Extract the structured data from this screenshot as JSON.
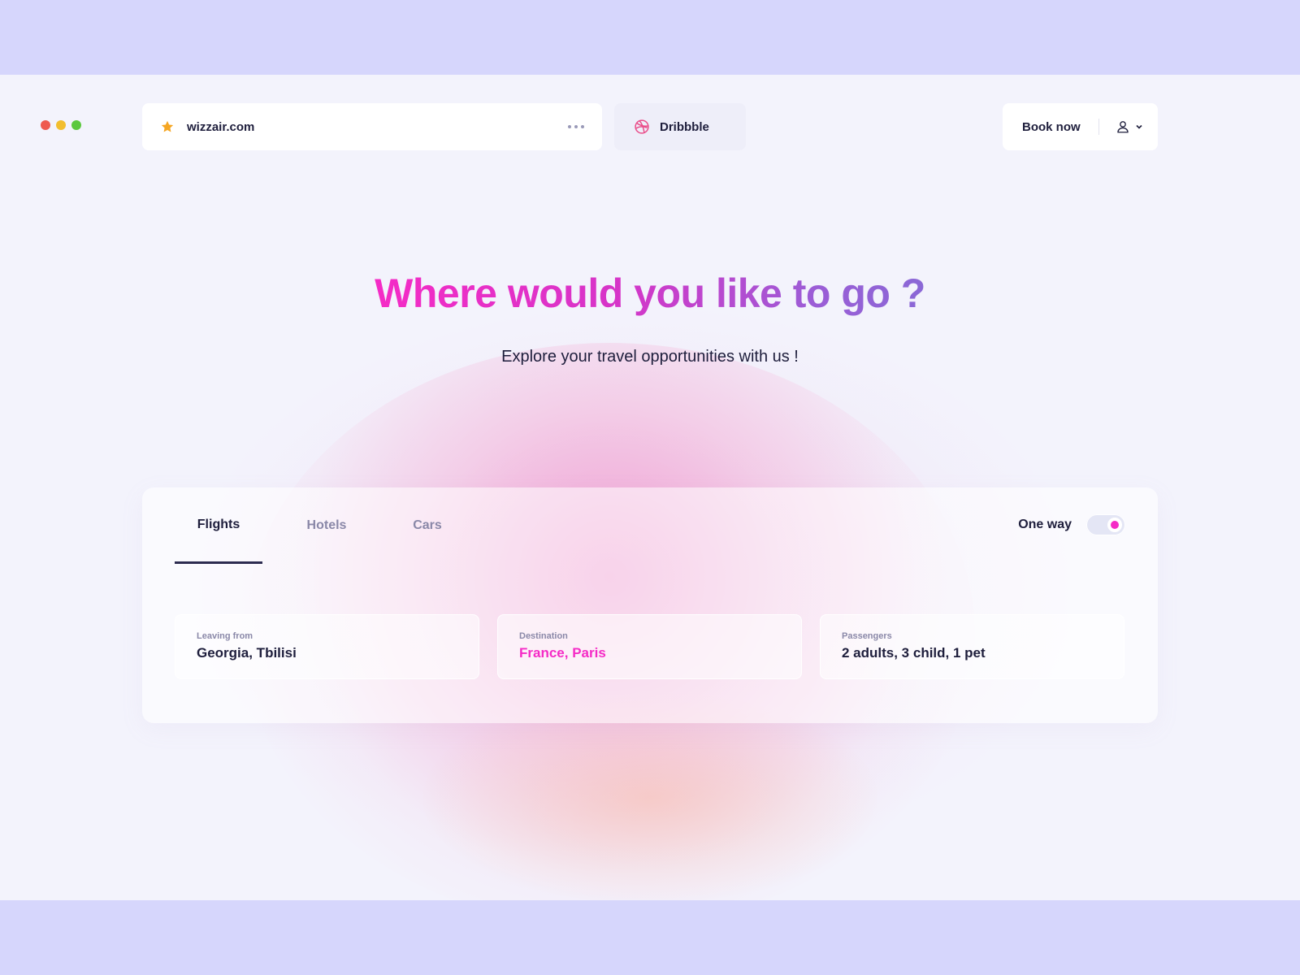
{
  "browser": {
    "url": "wizzair.com",
    "second_tab": "Dribbble"
  },
  "header": {
    "book_now": "Book now"
  },
  "hero": {
    "title": "Where would you like to go ?",
    "subtitle": "Explore your travel opportunities with us !"
  },
  "search": {
    "tabs": [
      {
        "label": "Flights",
        "active": true
      },
      {
        "label": "Hotels",
        "active": false
      },
      {
        "label": "Cars",
        "active": false
      }
    ],
    "one_way_label": "One way",
    "one_way_enabled": true,
    "fields": [
      {
        "label": "Leaving from",
        "value": "Georgia, Tbilisi"
      },
      {
        "label": "Destination",
        "value": "France, Paris"
      },
      {
        "label": "Passengers",
        "value": "2 adults, 3 child, 1 pet"
      }
    ]
  },
  "icons": {
    "star": "star-icon",
    "more": "more-dots-icon",
    "dribbble": "dribbble-icon",
    "user": "user-icon",
    "chevron": "chevron-down-icon"
  },
  "colors": {
    "accent": "#f52bc6",
    "accent_purple": "#8a68d6",
    "star": "#f5a623",
    "dribbble": "#ea4c89",
    "text": "#1e1e3c",
    "muted": "#8a88a8"
  }
}
